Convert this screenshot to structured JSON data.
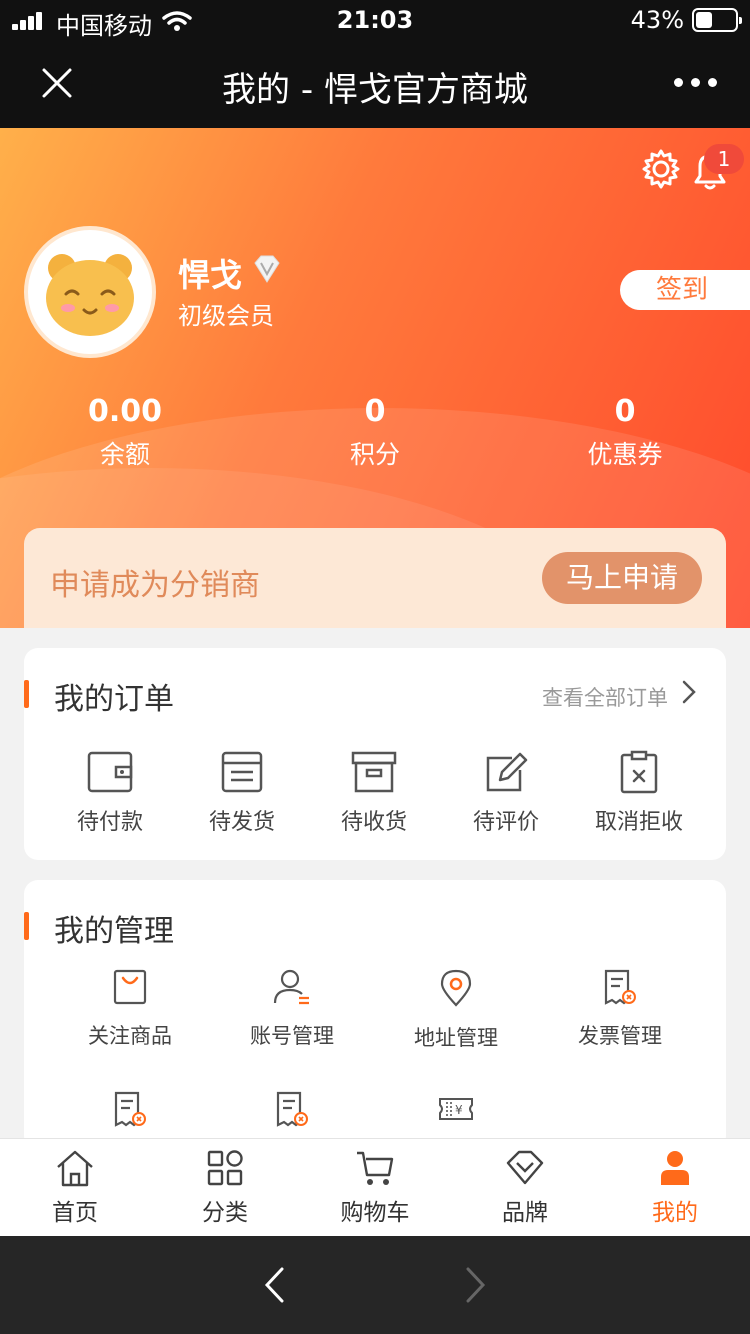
{
  "status_bar": {
    "carrier": "中国移动",
    "time": "21:03",
    "battery": "43%",
    "battery_level": 0.43
  },
  "title_bar": {
    "title": "我的 - 悍戈官方商城",
    "close_icon": "close-icon",
    "more_icon": "more-icon"
  },
  "profile": {
    "name": "悍戈",
    "level": "初级会员",
    "checkin": "签到",
    "notification_count": "1"
  },
  "stats": [
    {
      "value": "0.00",
      "label": "余额"
    },
    {
      "value": "0",
      "label": "积分"
    },
    {
      "value": "0",
      "label": "优惠券"
    }
  ],
  "distributor": {
    "text": "申请成为分销商",
    "button": "马上申请"
  },
  "orders": {
    "title": "我的订单",
    "view_all": "查看全部订单",
    "items": [
      {
        "label": "待付款",
        "icon": "wallet-icon"
      },
      {
        "label": "待发货",
        "icon": "document-icon"
      },
      {
        "label": "待收货",
        "icon": "archive-box-icon"
      },
      {
        "label": "待评价",
        "icon": "edit-icon"
      },
      {
        "label": "取消拒收",
        "icon": "cancel-clipboard-icon"
      }
    ]
  },
  "management": {
    "title": "我的管理",
    "items": [
      {
        "label": "关注商品",
        "icon": "shopping-bag-icon"
      },
      {
        "label": "账号管理",
        "icon": "user-icon"
      },
      {
        "label": "地址管理",
        "icon": "location-pin-icon"
      },
      {
        "label": "发票管理",
        "icon": "invoice-icon"
      }
    ],
    "partial_row_icons": [
      "invoice-icon",
      "invoice-icon",
      "ticket-icon"
    ]
  },
  "tabbar": [
    {
      "label": "首页",
      "icon": "home-icon",
      "active": false
    },
    {
      "label": "分类",
      "icon": "grid-icon",
      "active": false
    },
    {
      "label": "购物车",
      "icon": "cart-icon",
      "active": false
    },
    {
      "label": "品牌",
      "icon": "diamond-icon",
      "active": false
    },
    {
      "label": "我的",
      "icon": "person-icon",
      "active": true
    }
  ],
  "colors": {
    "accent": "#ff6a1a",
    "hero_start": "#ffb04a",
    "hero_end": "#ff4a2c",
    "dark_bar": "#111111"
  }
}
